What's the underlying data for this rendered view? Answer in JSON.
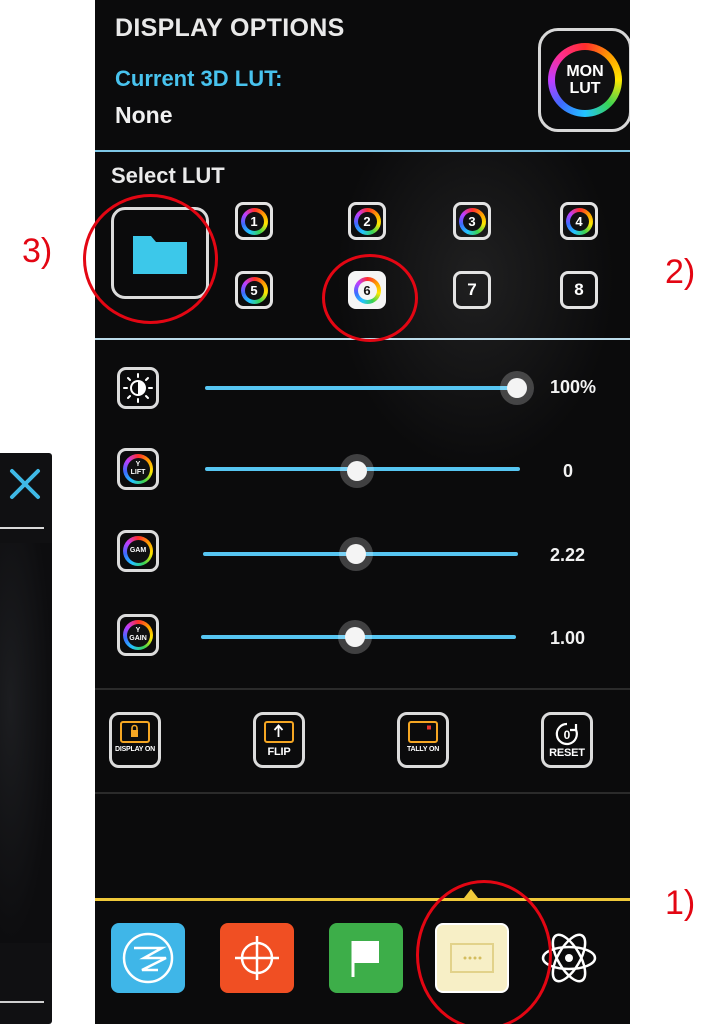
{
  "header": {
    "title": "DISPLAY OPTIONS",
    "current_lut_label": "Current 3D LUT:",
    "current_lut_value": "None",
    "mon_lut_button": [
      "MON",
      "LUT"
    ]
  },
  "select_lut": {
    "label": "Select LUT",
    "slots": [
      {
        "label": "1",
        "style": "color-ring",
        "selected": false
      },
      {
        "label": "2",
        "style": "color-ring",
        "selected": false
      },
      {
        "label": "3",
        "style": "color-ring",
        "selected": false
      },
      {
        "label": "4",
        "style": "color-ring",
        "selected": false
      },
      {
        "label": "5",
        "style": "color-ring",
        "selected": false
      },
      {
        "label": "6",
        "style": "color-ring",
        "selected": true
      },
      {
        "label": "7",
        "style": "plain",
        "selected": false
      },
      {
        "label": "8",
        "style": "plain",
        "selected": false
      }
    ]
  },
  "sliders": [
    {
      "icon": "brightness-icon",
      "value_label": "100%",
      "level": 1.0
    },
    {
      "icon": "y-lift-icon",
      "icon_text": [
        "Y",
        "LIFT"
      ],
      "value_label": "0",
      "level": 0.5
    },
    {
      "icon": "gamma-icon",
      "icon_text": [
        "GAM"
      ],
      "value_label": "2.22",
      "level": 0.5
    },
    {
      "icon": "y-gain-icon",
      "icon_text": [
        "Y",
        "GAIN"
      ],
      "value_label": "1.00",
      "level": 0.5
    }
  ],
  "function_buttons": [
    {
      "label": "DISPLAY ON",
      "icon": "lock-display-icon"
    },
    {
      "label": "FLIP",
      "icon": "flip-arrow-icon"
    },
    {
      "label": "TALLY ON",
      "icon": "tally-light-icon"
    },
    {
      "label": "RESET",
      "icon": "reset-icon",
      "icon_text": "0"
    }
  ],
  "tabs": [
    {
      "name": "scopes-tab",
      "icon": "waveform-icon",
      "color": "#3fb6e8"
    },
    {
      "name": "focus-tab",
      "icon": "crosshair-icon",
      "color": "#f04f23"
    },
    {
      "name": "markers-tab",
      "icon": "flag-icon",
      "color": "#3dae49"
    },
    {
      "name": "display-tab",
      "icon": "display-options-icon",
      "color": "#f7efc6",
      "active": true
    },
    {
      "name": "atomos-menu-tab",
      "icon": "atomos-logo-icon",
      "color": "#0b0b0c"
    }
  ],
  "annotations": [
    "1)",
    "2)",
    "3)"
  ],
  "colors": {
    "accent_blue": "#48c3ee",
    "slider_track": "#57c6f2",
    "tab_highlight": "#f0c93a",
    "function_icon": "#f5a623",
    "annotation_red": "#e30613"
  }
}
